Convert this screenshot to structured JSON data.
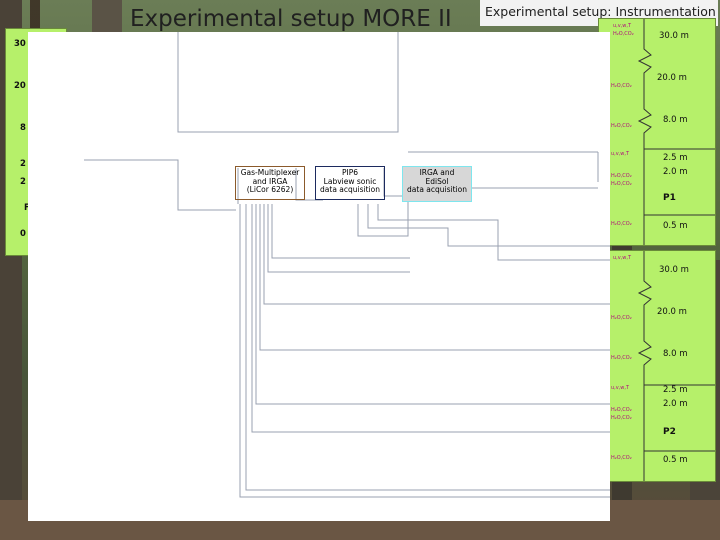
{
  "slide_title": "Experimental setup MORE II",
  "subtitle": "Experimental setup: Instrumentation",
  "left_panel_scale": [
    "30",
    "20",
    "8",
    "2",
    "2",
    "F",
    "0"
  ],
  "right_panel_p1": {
    "heights": [
      "30.0 m",
      "20.0 m",
      "8.0 m",
      "2.5 m",
      "2.0 m",
      "0.5 m"
    ],
    "label": "P1",
    "sensor_labels": [
      "u,v,w,T",
      "H₂O,CO₂",
      "H₂O,CO₂",
      "H₂O,CO₂",
      "u,v,w,T",
      "H₂O,CO₂",
      "H₂O,CO₂",
      "H₂O,CO₂"
    ]
  },
  "right_panel_p2": {
    "heights": [
      "30.0 m",
      "20.0 m",
      "8.0 m",
      "2.5 m",
      "2.0 m",
      "0.5 m"
    ],
    "label": "P2",
    "sensor_labels": [
      "u,v,w,T",
      "H₂O,CO₂",
      "H₂O,CO₂",
      "u,v,w,T",
      "H₂O,CO₂",
      "H₂O,CO₂",
      "H₂O,CO₂"
    ]
  },
  "boxes": {
    "gas": [
      "Gas-Multiplexer",
      "and IRGA",
      "(LiCor 6262)"
    ],
    "pip": [
      "PIP6",
      "Labview sonic",
      "data acquisition"
    ],
    "irga": [
      "IRGA and",
      "EdiSol",
      "data acquisition"
    ]
  },
  "colors": {
    "panel_green": "#b6f06a",
    "gas_border": "#8b5a2b",
    "pip_border": "#1c2a5e",
    "irga_border": "#7ee6ee",
    "irga_fill": "#d7d7d7",
    "co2_magenta": "#b0107a"
  }
}
